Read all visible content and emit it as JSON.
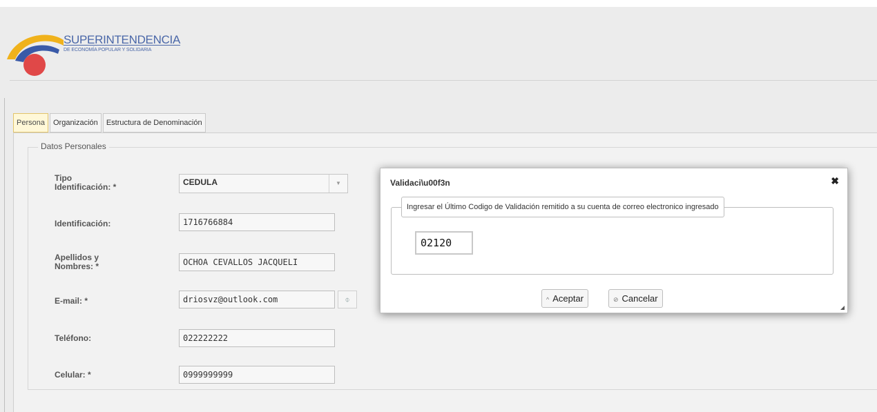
{
  "brand": {
    "title": "SUPERINTENDENCIA",
    "subtitle": "DE ECONOMÍA POPULAR Y SOLIDARIA",
    "colors": {
      "yellow": "#f0b21c",
      "blue": "#3a5aa8",
      "red": "#e04848",
      "text": "#4a67a8"
    }
  },
  "tabs": [
    {
      "label": "Persona",
      "active": true
    },
    {
      "label": "Organización",
      "active": false
    },
    {
      "label": "Estructura de Denominación",
      "active": false
    }
  ],
  "form": {
    "legend": "Datos Personales",
    "fields": {
      "tipo": {
        "label_line1": "Tipo",
        "label_line2": "Identificación: *",
        "value": "CEDULA",
        "arrow_icon": "chevron-down-icon"
      },
      "identificacion": {
        "label": "Identificación:",
        "value": "1716766884"
      },
      "nombres": {
        "label_line1": "Apellidos y",
        "label_line2": "Nombres: *",
        "value": "OCHOA CEVALLOS JACQUELI"
      },
      "email": {
        "label": "E-mail: *",
        "value": "driosvz@outlook.com",
        "button_icon": "refresh-icon",
        "button_glyph": "⌽"
      },
      "telefono": {
        "label": "Teléfono:",
        "value": "022222222"
      },
      "celular": {
        "label": "Celular: *",
        "value": "0999999999"
      }
    }
  },
  "dialog": {
    "title": "Validaci\\u00f3n",
    "close_glyph": "✖",
    "legend": "Ingresar el Último Codigo de Validación remitido a su cuenta de correo electronico ingresado",
    "code_value": "02120",
    "accept_label": "Aceptar",
    "accept_glyph": "^",
    "cancel_label": "Cancelar",
    "cancel_glyph": "⊘"
  }
}
